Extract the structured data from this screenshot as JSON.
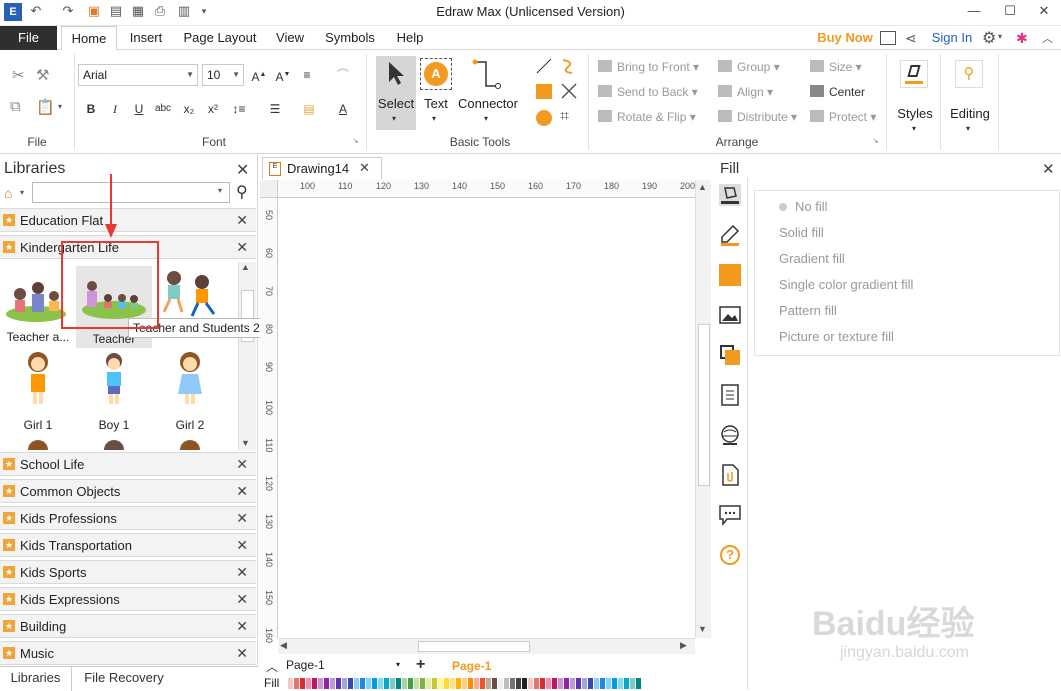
{
  "window": {
    "title": "Edraw Max (Unlicensed Version)"
  },
  "menu": {
    "tabs": [
      "File",
      "Home",
      "Insert",
      "Page Layout",
      "View",
      "Symbols",
      "Help"
    ],
    "buy_now": "Buy Now",
    "sign_in": "Sign In"
  },
  "ribbon": {
    "file_group": "File",
    "font_group": "Font",
    "font_name": "Arial",
    "font_size": "10",
    "basic_tools_group": "Basic Tools",
    "select_label": "Select",
    "text_label": "Text",
    "connector_label": "Connector",
    "arrange_group": "Arrange",
    "bring_to_front": "Bring to Front",
    "send_to_back": "Send to Back",
    "rotate_flip": "Rotate & Flip",
    "group": "Group",
    "align": "Align",
    "distribute": "Distribute",
    "size": "Size",
    "center": "Center",
    "protect": "Protect",
    "styles": "Styles",
    "editing": "Editing"
  },
  "libraries": {
    "title": "Libraries",
    "search_value": "",
    "categories": [
      "Education Flat",
      "Kindergarten Life"
    ],
    "shapes_row1": [
      "Teacher a...",
      "Teacher",
      ""
    ],
    "tooltip": "Teacher and Students 2",
    "shapes_row2": [
      "Girl 1",
      "Boy 1",
      "Girl 2"
    ],
    "more_categories": [
      "School Life",
      "Common Objects",
      "Kids Professions",
      "Kids Transportation",
      "Kids Sports",
      "Kids Expressions",
      "Building",
      "Music"
    ],
    "bottom_tabs": [
      "Libraries",
      "File Recovery"
    ]
  },
  "document": {
    "tab_name": "Drawing14",
    "ruler_h": [
      "100",
      "110",
      "120",
      "130",
      "140",
      "150",
      "160",
      "170",
      "180",
      "190",
      "200"
    ],
    "ruler_v": [
      "50",
      "60",
      "70",
      "80",
      "90",
      "100",
      "110",
      "120",
      "130",
      "140",
      "150",
      "160"
    ],
    "page_select": "Page-1",
    "active_page": "Page-1",
    "fill_label": "Fill"
  },
  "fill_panel": {
    "title": "Fill",
    "options": [
      "No fill",
      "Solid fill",
      "Gradient fill",
      "Single color gradient fill",
      "Pattern fill",
      "Picture or texture fill"
    ]
  },
  "colors": {
    "accent": "#f39a1e",
    "highlight_red": "#e53935",
    "ribbon_selected": "#d6d6d6"
  },
  "watermark": {
    "text": "Baidu经验",
    "sub": "jingyan.baidu.com"
  }
}
